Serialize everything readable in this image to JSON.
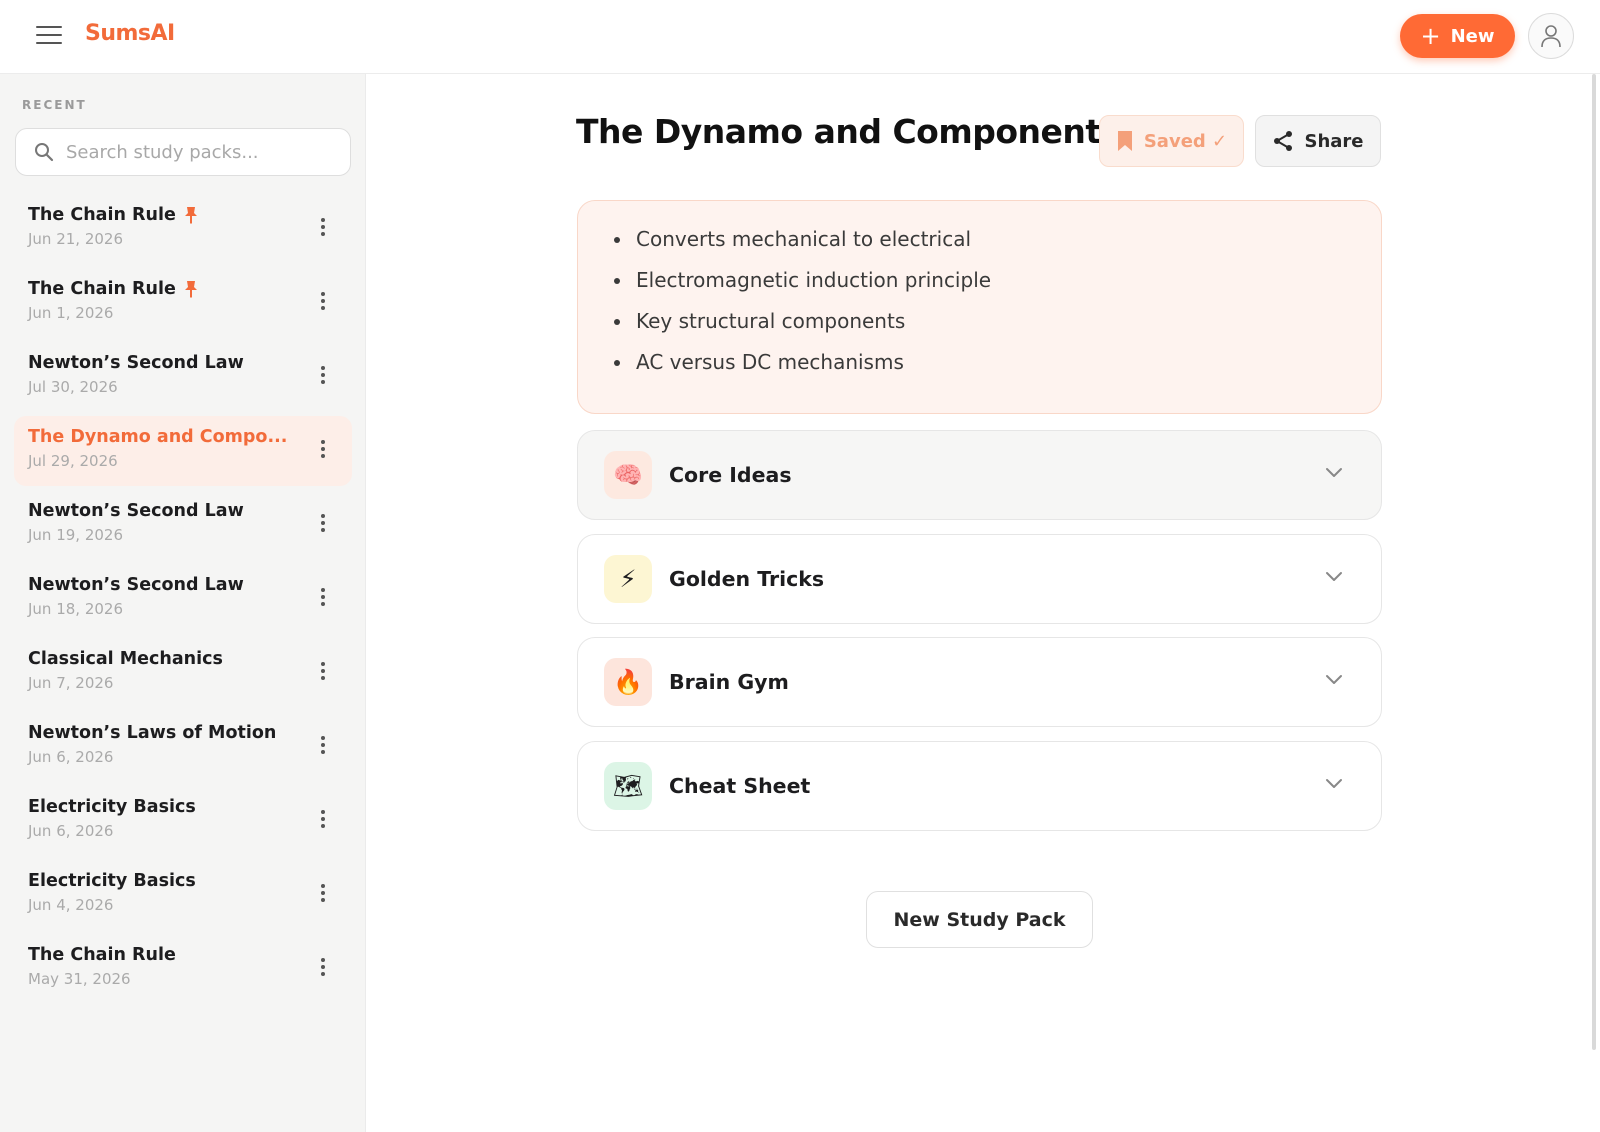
{
  "app": {
    "brand": "SumsAI",
    "new_button_label": "New"
  },
  "sidebar": {
    "section_label": "RECENT",
    "search_placeholder": "Search study packs...",
    "items": [
      {
        "title": "The Chain Rule",
        "date": "Jun 21, 2026",
        "pinned": true,
        "active": false
      },
      {
        "title": "The Chain Rule",
        "date": "Jun 1, 2026",
        "pinned": true,
        "active": false
      },
      {
        "title": "Newton’s Second Law",
        "date": "Jul 30, 2026",
        "pinned": false,
        "active": false
      },
      {
        "title": "The Dynamo and Compo...",
        "date": "Jul 29, 2026",
        "pinned": false,
        "active": true
      },
      {
        "title": "Newton’s Second Law",
        "date": "Jun 19, 2026",
        "pinned": false,
        "active": false
      },
      {
        "title": "Newton’s Second Law",
        "date": "Jun 18, 2026",
        "pinned": false,
        "active": false
      },
      {
        "title": "Classical Mechanics",
        "date": "Jun 7, 2026",
        "pinned": false,
        "active": false
      },
      {
        "title": "Newton’s Laws of Motion",
        "date": "Jun 6, 2026",
        "pinned": false,
        "active": false
      },
      {
        "title": "Electricity Basics",
        "date": "Jun 6, 2026",
        "pinned": false,
        "active": false
      },
      {
        "title": "Electricity Basics",
        "date": "Jun 4, 2026",
        "pinned": false,
        "active": false
      },
      {
        "title": "The Chain Rule",
        "date": "May 31, 2026",
        "pinned": false,
        "active": false
      }
    ]
  },
  "main": {
    "title": "The Dynamo and Components",
    "saved_label": "Saved ✓",
    "share_label": "Share",
    "summary_points": [
      "Converts mechanical to electrical",
      "Electromagnetic induction principle",
      "Key structural components",
      "AC versus DC mechanisms"
    ],
    "sections": [
      {
        "title": "Core Ideas",
        "icon": "brain-icon",
        "glyph": "🧠",
        "icon_bg": "#fde9e0"
      },
      {
        "title": "Golden Tricks",
        "icon": "lightning-icon",
        "glyph": "⚡",
        "icon_bg": "#fdf6d3"
      },
      {
        "title": "Brain Gym",
        "icon": "fire-icon",
        "glyph": "🔥",
        "icon_bg": "#fde5dc"
      },
      {
        "title": "Cheat Sheet",
        "icon": "map-icon",
        "glyph": "🗺",
        "icon_bg": "#dcf5e6"
      }
    ],
    "new_pack_label": "New Study Pack"
  },
  "colors": {
    "accent": "#ff6a35",
    "brand": "#f26b3a",
    "active_bg": "#fdeee8",
    "summary_bg": "#fef3ef"
  }
}
